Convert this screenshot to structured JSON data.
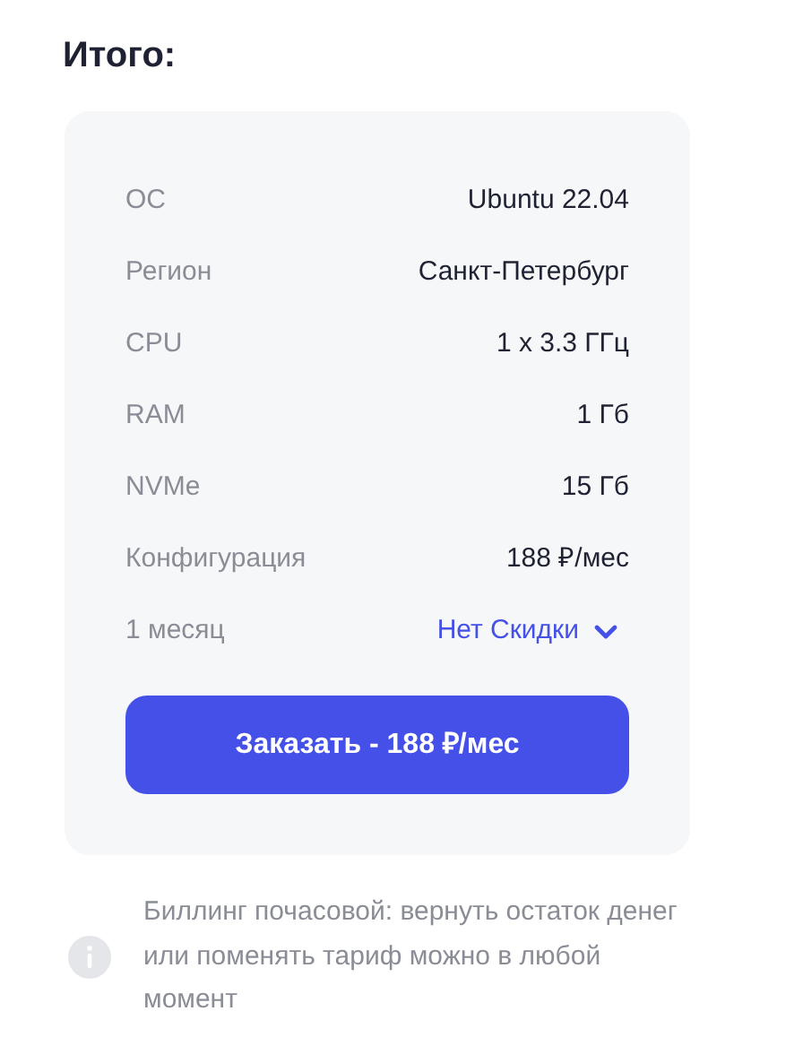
{
  "title": "Итого:",
  "rows": [
    {
      "kind": "value",
      "label": "ОС",
      "value": "Ubuntu 22.04"
    },
    {
      "kind": "value",
      "label": "Регион",
      "value": "Санкт-Петербург"
    },
    {
      "kind": "value",
      "label": "CPU",
      "value": "1 x 3.3 ГГц"
    },
    {
      "kind": "value",
      "label": "RAM",
      "value": "1 Гб"
    },
    {
      "kind": "value",
      "label": "NVMe",
      "value": "15 Гб"
    },
    {
      "kind": "value",
      "label": "Конфигурация",
      "value": "188 ₽/мес"
    },
    {
      "kind": "dropdown",
      "label": "1 месяц",
      "value": "Нет Скидки"
    }
  ],
  "order_button": "Заказать - 188 ₽/мес",
  "note": "Биллинг почасовой: вернуть остаток денег или поменять тариф можно в любой момент"
}
